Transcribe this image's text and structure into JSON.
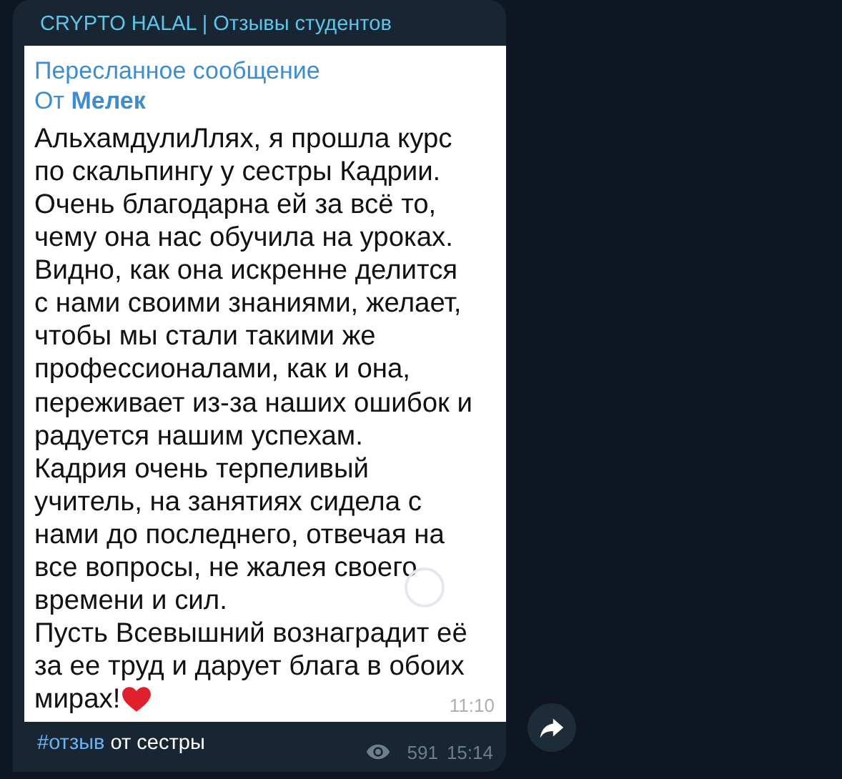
{
  "channel": {
    "title": "CRYPTO HALAL | Отзывы студентов"
  },
  "screenshot": {
    "forwarded_label": "Пересланное сообщение",
    "from_prefix": "От",
    "from_name": "Мелек",
    "lines": [
      "АльхамдулиЛлях, я прошла курс",
      "по скальпингу у сестры Кадрии.",
      "Очень благодарна ей за всё то,",
      "чему она нас обучила на уроках.",
      "Видно, как она искренне делится",
      "с нами своими знаниями, желает,",
      "чтобы мы стали такими же",
      "профессионалами, как и она,",
      "переживает из-за наших ошибок и",
      "радуется нашим успехам.",
      "Кадрия очень терпеливый",
      "учитель, на занятиях сидела с",
      "нами до последнего, отвечая на",
      "все вопросы, не жалея своего",
      "времени и сил.",
      "Пусть Всевышний вознаградит её",
      "за ее труд и дарует блага в обоих",
      "мирах!"
    ],
    "time": "11:10"
  },
  "caption": {
    "hashtag": "#отзыв",
    "text": "от сестры"
  },
  "views": "591",
  "time": "15:14"
}
